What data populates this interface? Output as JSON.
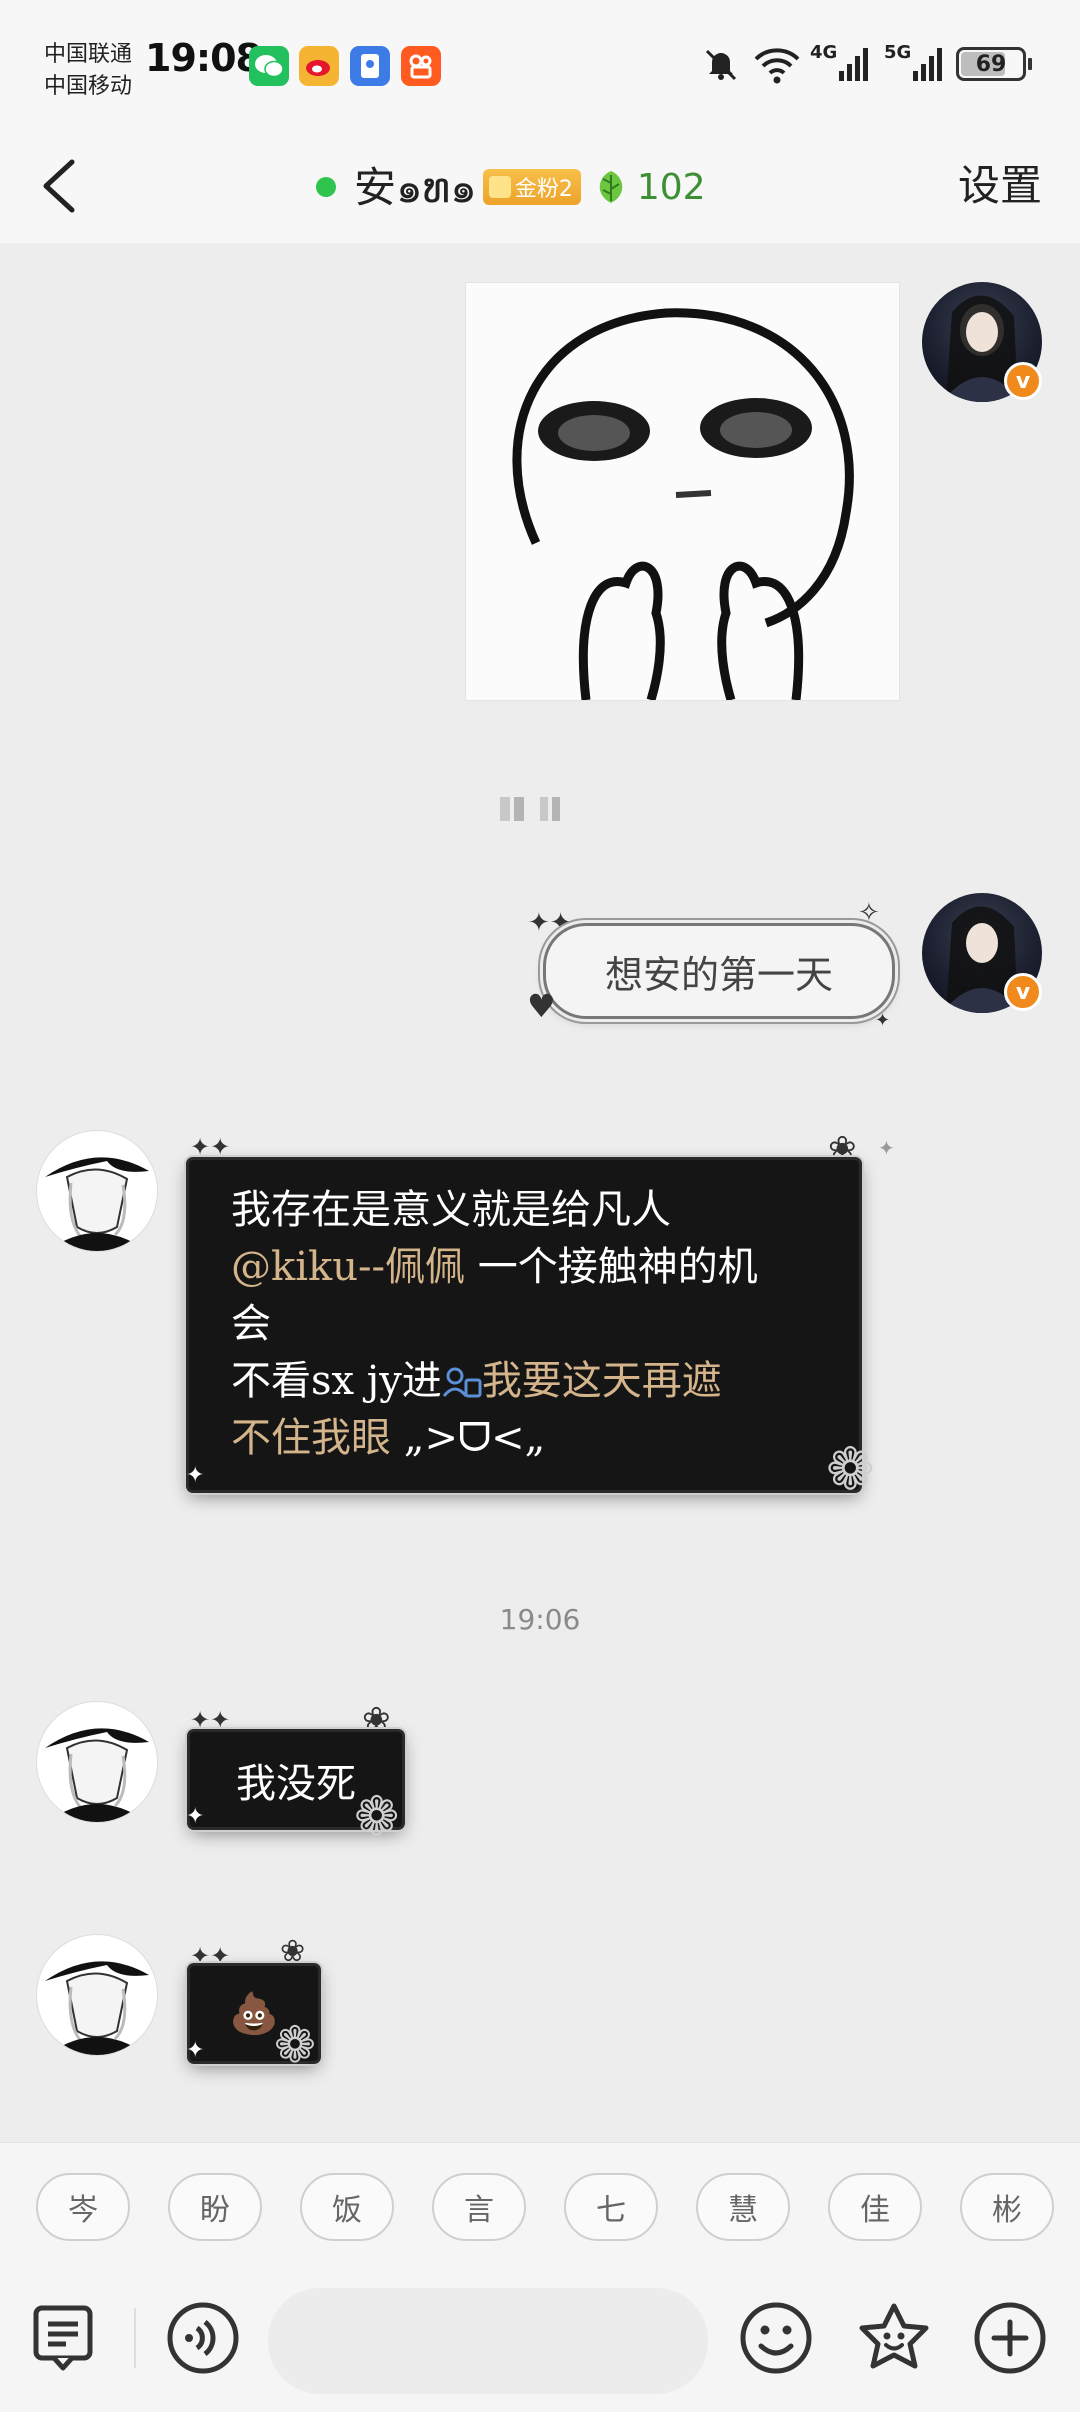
{
  "status_bar": {
    "carrier_1": "中国联通",
    "carrier_2": "中国移动",
    "time": "19:08",
    "apps": [
      "wechat-icon",
      "weibo-icon",
      "app-icon",
      "kuaishou-icon"
    ],
    "network_1": "4G",
    "network_2": "5G",
    "battery": "69"
  },
  "header": {
    "back_icon": "chevron-left-icon",
    "title": "安๑ທ๑",
    "fan_badge": "金粉2",
    "score": "102",
    "settings_label": "设置"
  },
  "chat": {
    "messages": [
      {
        "side": "right",
        "type": "sticker",
        "sticker": "meme face with hands"
      },
      {
        "side": "right",
        "type": "text",
        "text": "想安的第一天"
      },
      {
        "side": "left",
        "type": "text",
        "line1": "我存在是意义就是给凡人",
        "mention": "@kiku--佩佩",
        "line2_rest": " 一个接触神的机",
        "line3": "会",
        "line4_a": "不看sx jy进",
        "line4_b": "我要这天再遮",
        "line5_a": "不住我眼",
        "line5_b": " „>ᗜ<„"
      },
      {
        "side": "left",
        "type": "text",
        "text": "我没死"
      },
      {
        "side": "left",
        "type": "emoji",
        "text": "💩"
      }
    ],
    "timestamp": "19:06"
  },
  "suggestions": [
    "岑",
    "盼",
    "饭",
    "言",
    "七",
    "慧",
    "佳",
    "彬"
  ],
  "input_bar": {
    "placeholder": "",
    "icons": [
      "chat-menu-icon",
      "voice-icon",
      "emoji-icon",
      "sticker-star-icon",
      "add-icon"
    ]
  },
  "colors": {
    "online": "#2ec44e",
    "gold_text": "#d4b48a",
    "vip_badge": "#f08a1c",
    "score": "#3c8f33"
  }
}
